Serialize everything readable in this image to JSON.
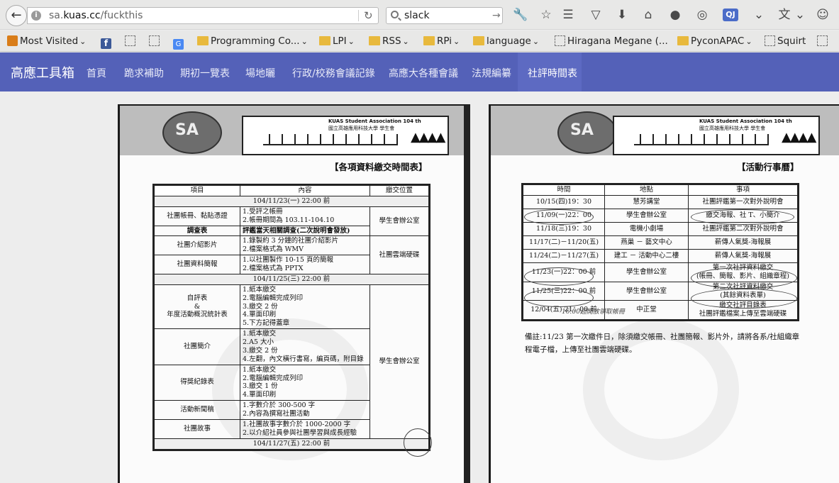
{
  "browser": {
    "url_prefix": "sa.",
    "url_domain": "kuas.cc",
    "url_path": "/fuckthis",
    "search_query": "slack",
    "bookmarks": [
      {
        "label": "Most Visited",
        "icon": "most-visited-icon"
      },
      {
        "label": "",
        "icon": "facebook-icon"
      },
      {
        "label": "",
        "icon": "dashed-bookmark-icon"
      },
      {
        "label": "",
        "icon": "dashed-bookmark-icon"
      },
      {
        "label": "",
        "icon": "google-translate-icon"
      },
      {
        "label": "Programming Co...",
        "icon": "folder-icon"
      },
      {
        "label": "LPI",
        "icon": "folder-icon"
      },
      {
        "label": "RSS",
        "icon": "folder-icon"
      },
      {
        "label": "RPi",
        "icon": "folder-icon"
      },
      {
        "label": "language",
        "icon": "folder-icon"
      },
      {
        "label": "Hiragana Megane (...",
        "icon": "dashed-bookmark-icon"
      },
      {
        "label": "PyconAPAC",
        "icon": "folder-icon"
      },
      {
        "label": "Squirt",
        "icon": "dashed-bookmark-icon"
      }
    ],
    "toolbar_icon_badge": "QJ"
  },
  "site": {
    "brand": "高應工具箱",
    "nav": [
      "首頁",
      "跪求補助",
      "期初一覽表",
      "場地曬",
      "行政/校務會議記錄",
      "高應大各種會議",
      "法規編纂",
      "社評時間表"
    ],
    "accent": "#5461b8"
  },
  "left_doc": {
    "header_en": "KUAS Student Association 104 th",
    "header_zh": "國立高雄應用科技大學 學生會",
    "logo_text": "SA",
    "title": "【各項資料繳交時間表】",
    "columns": [
      "項目",
      "內容",
      "繳交位置"
    ],
    "band1": "104/11/23(一) 22:00 前",
    "band2": "104/11/25(三) 22:00 前",
    "band3": "104/11/27(五) 22:00 前",
    "rows": {
      "r1_item": "社團帳冊、黏貼憑證",
      "r1_content": "1.受評之帳冊\n2.帳冊期間為 103.11-104.10",
      "r1_place": "學生會辦公室",
      "r2_item": "調查表",
      "r2_content": "評鑑當天相關調查(二次說明會發放)",
      "r3_item": "社團介紹影片",
      "r3_content": "1.錄製約 3 分鐘的社團介紹影片\n2.檔案格式為 WMV",
      "r3_place": "社團雲端硬碟",
      "r4_item": "社團資料簡報",
      "r4_content": "1.以社團製作 10-15 頁的簡報\n2.檔案格式為 PPTX",
      "r5_item": "自評表\n&\n年度活動概況統計表",
      "r5_content": "1.紙本繳交\n2.電腦編輯完成列印\n3.繳交 2 份\n4.單面印刷\n5.下方記得蓋章",
      "r6_item": "社團簡介",
      "r6_content": "1.紙本繳交\n2.A5 大小\n3.繳交 2 份\n4.左翻，內文橫行書寫，編頁碼，附目錄",
      "r6_place": "學生會辦公室",
      "r7_item": "得獎紀錄表",
      "r7_content": "1.紙本繳交\n2.電腦編輯完成列印\n3.繳交 1 份\n4.單面印刷",
      "r8_item": "活動新聞稿",
      "r8_content": "1.字數介於 300-500 字\n2.內容為撰寫社團活動",
      "r9_item": "社團故事",
      "r9_content": "1.社團故事字數介於 1000-2000 字\n2.以介紹社員參與社團學習與成長經驗"
    },
    "watermark": "STUDENT ASSOCIATION"
  },
  "right_doc": {
    "header_en": "KUAS Student Association 104 th",
    "header_zh": "國立高雄應用科技大學 學生會",
    "logo_text": "SA",
    "title": "【活動行事曆】",
    "columns": [
      "時間",
      "地點",
      "事項"
    ],
    "events": [
      {
        "time": "10/15(四)19：30",
        "place": "慧芳講堂",
        "item": "社團評鑑第一次對外說明會"
      },
      {
        "time": "11/09(一)22：00",
        "place": "學生會辦公室",
        "item": "繳交海報、社 T、小簡介"
      },
      {
        "time": "11/18(三)19：30",
        "place": "電機小劇場",
        "item": "社團評鑑第二次對外說明會"
      },
      {
        "time": "11/17(二)－11/20(五)",
        "place": "燕巢 － 藝文中心",
        "item": "薪傳人氣獎-海報展"
      },
      {
        "time": "11/24(二)－11/27(五)",
        "place": "建工 － 活動中心二樓",
        "item": "薪傳人氣獎-海報展"
      },
      {
        "time": "11/23(一)22：00 前",
        "place": "學生會辦公室",
        "item": "第一次社評資料繳交\n(帳冊、簡報、影片、組織章程)"
      },
      {
        "time": "11/25(三)22：00 前",
        "place": "學生會辦公室",
        "item": "第二次社評資料繳交\n(其餘資料表單)"
      },
      {
        "time": "12/04(五) 21：00 前",
        "place": "中正堂",
        "item": "繳交社評目錄表\n社團評鑑檔案上傳至雲端硬碟"
      }
    ],
    "handwritten": "16:00起開放領取帳冊",
    "note": "備註:11/23 第一次繳件日，除須繳交帳冊、社團簡報、影片外，請將各系/社組織章程電子檔，上傳至社團雲端硬碟。",
    "watermark": "STUDENT ASSOCIATION"
  }
}
